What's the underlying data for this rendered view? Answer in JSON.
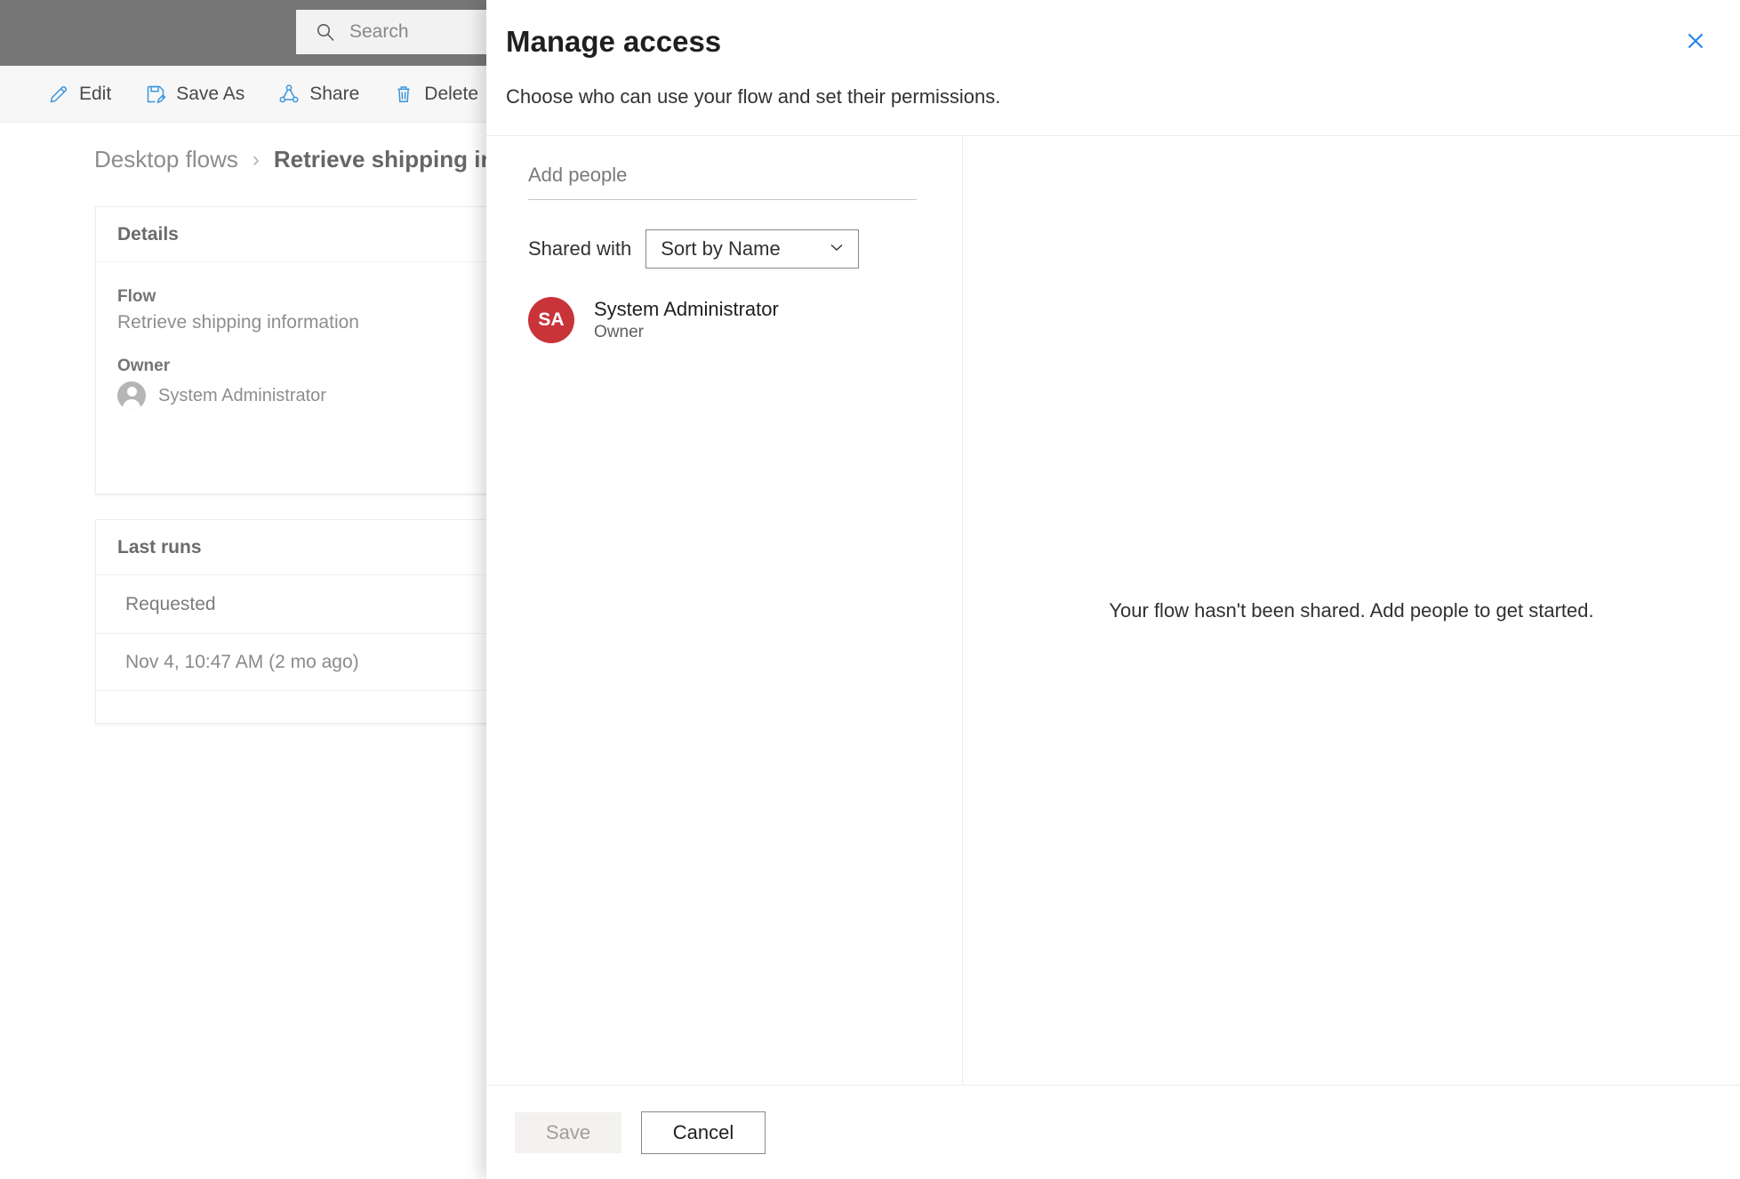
{
  "app": {
    "search": {
      "placeholder": "Search",
      "icon": "search-icon"
    },
    "command_bar": [
      {
        "label": "Edit",
        "icon": "pencil-icon"
      },
      {
        "label": "Save As",
        "icon": "save-as-icon"
      },
      {
        "label": "Share",
        "icon": "share-icon"
      },
      {
        "label": "Delete",
        "icon": "trash-icon"
      }
    ],
    "breadcrumb": {
      "parent": "Desktop flows",
      "separator": "›",
      "current": "Retrieve shipping information"
    },
    "details_card": {
      "header": "Details",
      "flow_label": "Flow",
      "flow_value": "Retrieve shipping information",
      "owner_label": "Owner",
      "owner_value": "System Administrator"
    },
    "last_runs_card": {
      "header": "Last runs",
      "columns": [
        "Requested"
      ],
      "rows": [
        [
          "Nov 4, 10:47 AM (2 mo ago)"
        ]
      ]
    }
  },
  "panel": {
    "title": "Manage access",
    "subtitle": "Choose who can use your flow and set their permissions.",
    "close_icon": "close-icon",
    "close_color": "#1a7ef0",
    "add_people": {
      "placeholder": "Add people",
      "value": ""
    },
    "shared_with_label": "Shared with",
    "sort_select": {
      "value": "Sort by Name",
      "options": [
        "Sort by Name"
      ],
      "chevron_icon": "chevron-down-icon"
    },
    "shared_people": [
      {
        "initials": "SA",
        "name": "System Administrator",
        "role": "Owner",
        "avatar_color": "#c9343b"
      }
    ],
    "empty_state": "Your flow hasn't been shared. Add people to get started.",
    "footer": {
      "save_label": "Save",
      "cancel_label": "Cancel"
    }
  }
}
